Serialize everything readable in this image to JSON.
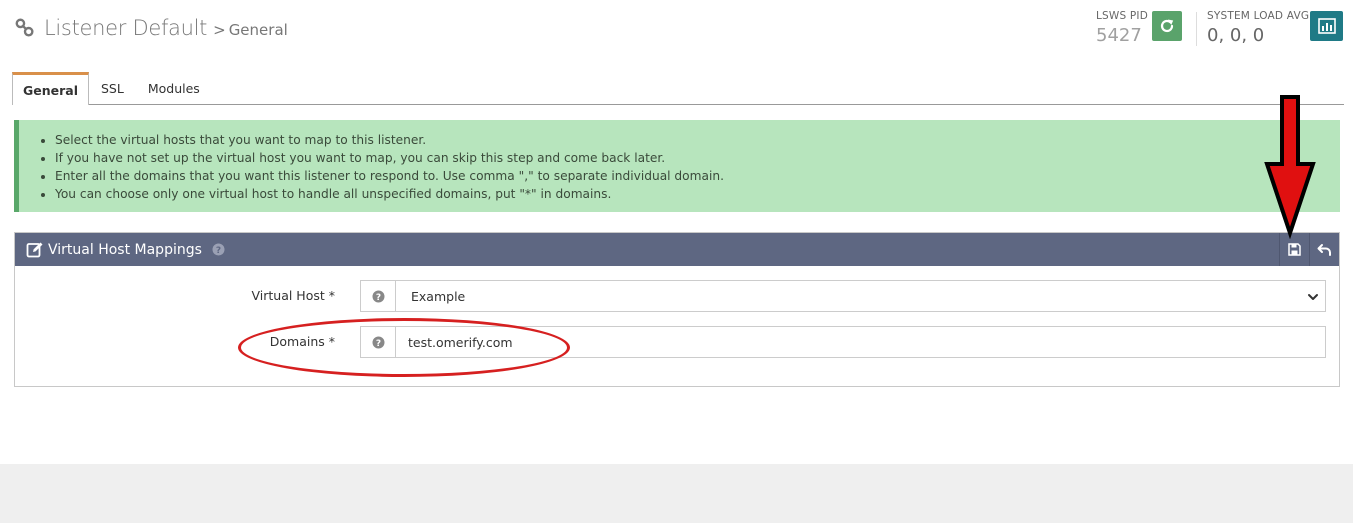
{
  "header": {
    "title_main": "Listener Default",
    "title_separator": ">",
    "title_sub": "General",
    "title_icon": "link-icon",
    "pid_label": "LSWS PID",
    "pid_value": "5427",
    "load_label": "SYSTEM LOAD AVG",
    "load_value": "0, 0, 0",
    "restart_icon": "refresh-icon",
    "chart_icon": "bar-chart-icon"
  },
  "tabs": [
    {
      "label": "General",
      "active": true
    },
    {
      "label": "SSL",
      "active": false
    },
    {
      "label": "Modules",
      "active": false
    }
  ],
  "info": {
    "items": [
      "Select the virtual hosts that you want to map to this listener.",
      "If you have not set up the virtual host you want to map, you can skip this step and come back later.",
      "Enter all the domains that you want this listener to respond to. Use comma \",\" to separate individual domain.",
      "You can choose only one virtual host to handle all unspecified domains, put \"*\" in domains."
    ]
  },
  "panel": {
    "title": "Virtual Host Mappings",
    "icons": [
      "edit-icon",
      "help-icon",
      "save-icon",
      "undo-icon"
    ]
  },
  "form": {
    "virtual_host_label": "Virtual Host *",
    "virtual_host_value": "Example",
    "domains_label": "Domains *",
    "domains_value": "test.omerify.com"
  },
  "colors": {
    "panel_header": "#5e6782",
    "info_bg": "#b7e5bd",
    "info_border": "#5aa86a",
    "restart_btn": "#5aa36b",
    "chart_btn": "#1f7a86",
    "active_tab_accent": "#d9904a",
    "annotation_red": "#d62020"
  }
}
